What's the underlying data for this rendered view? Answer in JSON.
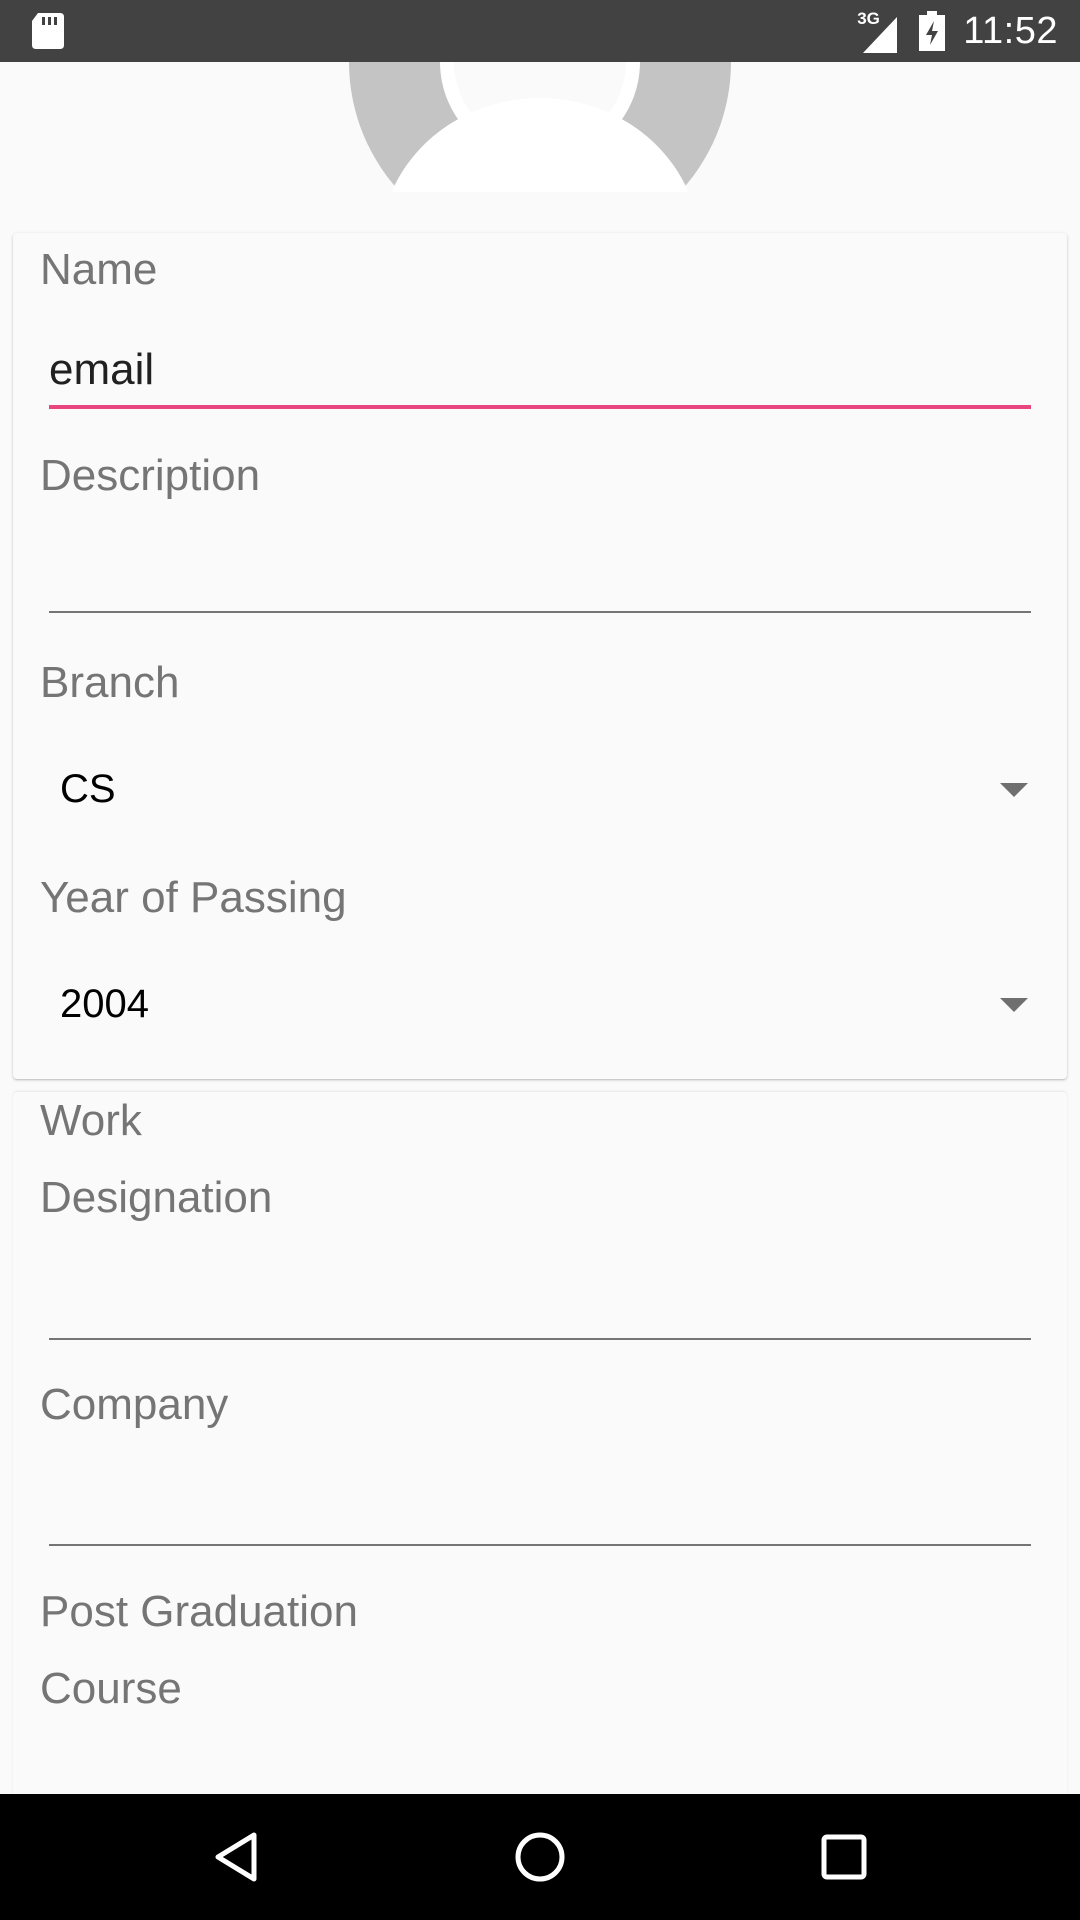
{
  "status_bar": {
    "time": "11:52",
    "network": "3G",
    "icons": [
      "sd-card-icon",
      "signal-icon",
      "battery-charging-icon"
    ]
  },
  "profile": {
    "avatar_icon": "default-avatar-icon"
  },
  "basic_info": {
    "name_label": "Name",
    "name_value": "email",
    "description_label": "Description",
    "description_value": "",
    "branch_label": "Branch",
    "branch_selected": "CS",
    "year_label": "Year of Passing",
    "year_selected": "2004"
  },
  "work": {
    "section_label": "Work",
    "designation_label": "Designation",
    "designation_value": "",
    "company_label": "Company",
    "company_value": "",
    "post_graduation_label": "Post Graduation",
    "course_label": "Course"
  },
  "nav_bar": {
    "icons": [
      "back-icon",
      "home-icon",
      "recents-icon"
    ]
  },
  "colors": {
    "accent": "#e94680",
    "status_bar": "#424242",
    "label": "#757575"
  }
}
